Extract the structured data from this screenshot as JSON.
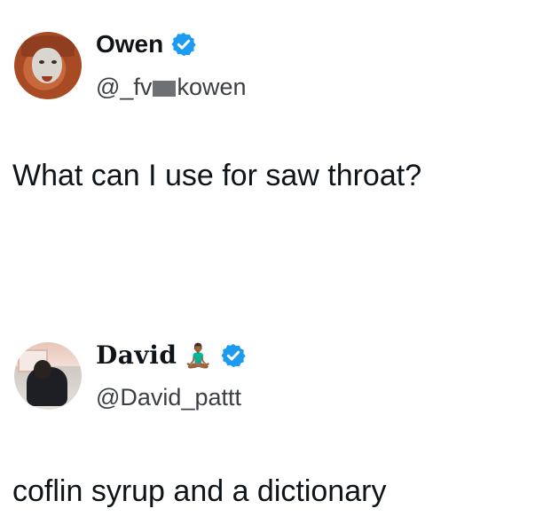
{
  "posts": [
    {
      "display_name": "Owen",
      "handle_prefix": "@_fv",
      "handle_suffix": "kowen",
      "verified": true,
      "text": "What can I use for saw throat?",
      "avatar_icon": "avatar-face-mask-icon"
    },
    {
      "display_name": "David",
      "name_emoji": "🧘🏾‍♂️",
      "handle": "@David_pattt",
      "verified": true,
      "text": "coflin syrup and a dictionary",
      "avatar_icon": "avatar-person-icon"
    }
  ],
  "colors": {
    "verified_blue": "#1d9bf0",
    "text": "#0f1419",
    "handle": "#3b3f44"
  }
}
